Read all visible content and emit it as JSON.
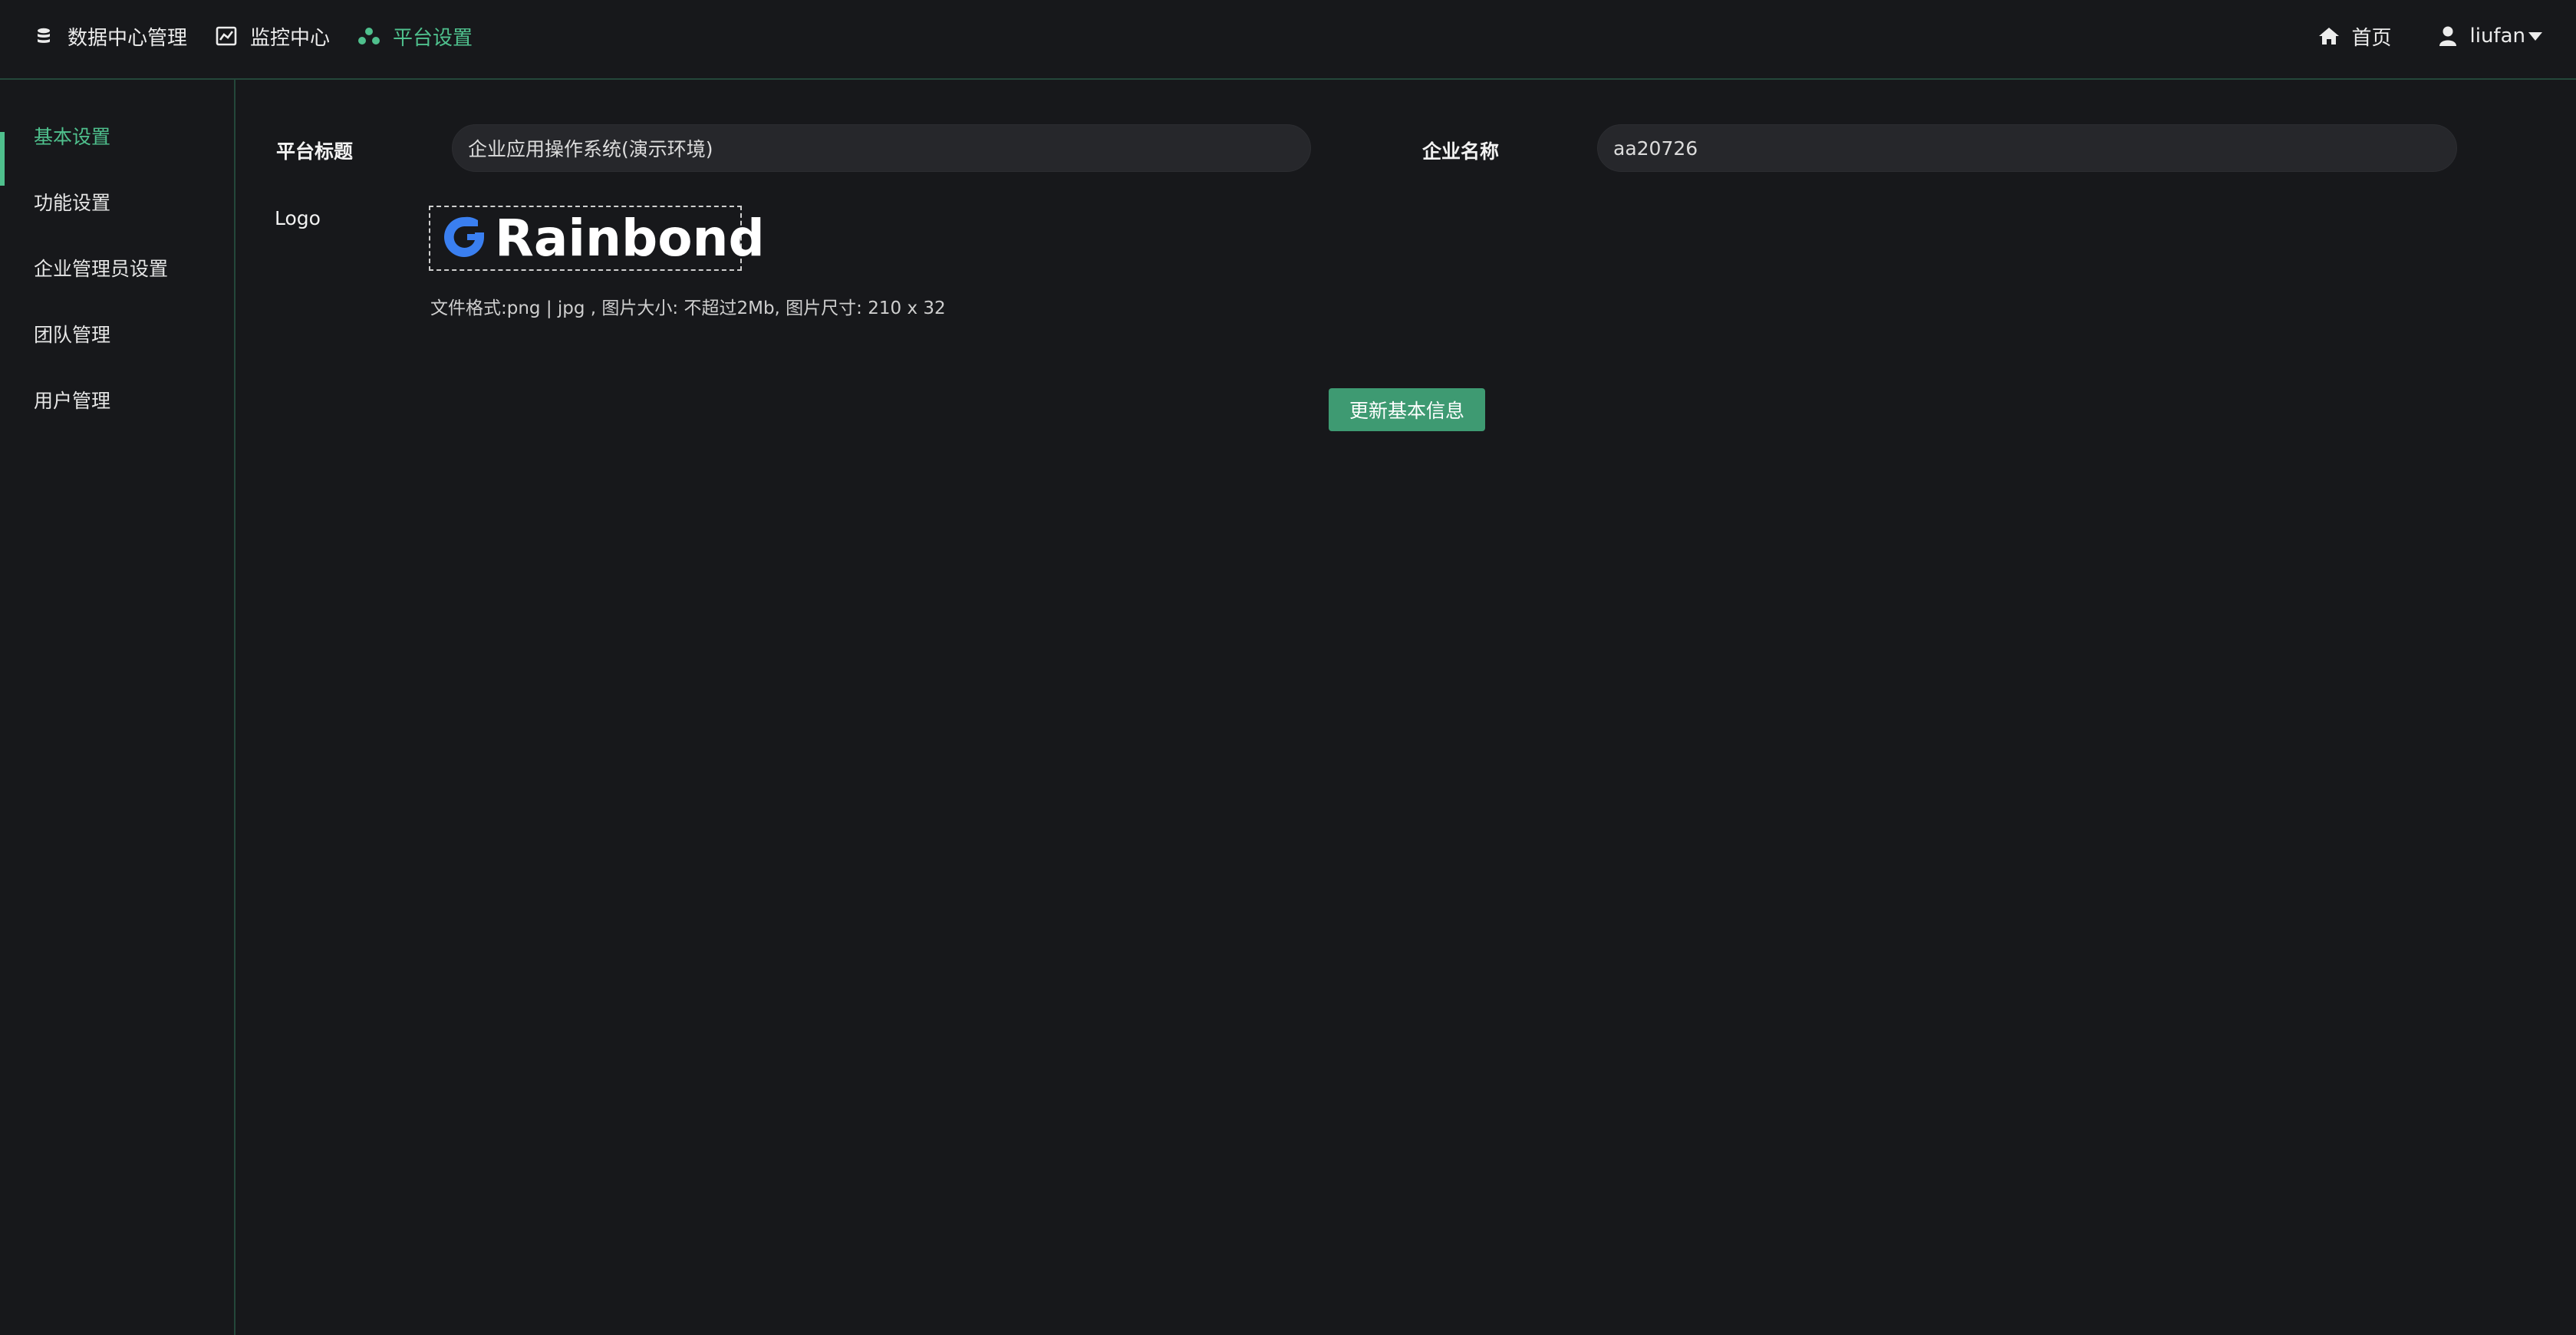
{
  "topnav": {
    "items": [
      {
        "label": "数据中心管理",
        "icon": "database-icon"
      },
      {
        "label": "监控中心",
        "icon": "line-chart-icon"
      },
      {
        "label": "平台设置",
        "icon": "cluster-icon",
        "active": true
      }
    ],
    "home_label": "首页",
    "user_label": "liufan"
  },
  "sidebar": {
    "items": [
      {
        "label": "基本设置",
        "active": true
      },
      {
        "label": "功能设置"
      },
      {
        "label": "企业管理员设置"
      },
      {
        "label": "团队管理"
      },
      {
        "label": "用户管理"
      }
    ]
  },
  "form": {
    "platform_title_label": "平台标题",
    "platform_title_value": "企业应用操作系统(演示环境)",
    "company_name_label": "企业名称",
    "company_name_value": "aa20726",
    "logo_label": "Logo",
    "logo_text": "Rainbond",
    "logo_hint": "文件格式:png | jpg , 图片大小: 不超过2Mb, 图片尺寸: 210 x 32",
    "update_button": "更新基本信息"
  },
  "colors": {
    "background": "#17181b",
    "accent": "#4fc08d",
    "button": "#3e9a72",
    "input_bg": "#26272b",
    "logo_blue": "#3a7ff0"
  }
}
